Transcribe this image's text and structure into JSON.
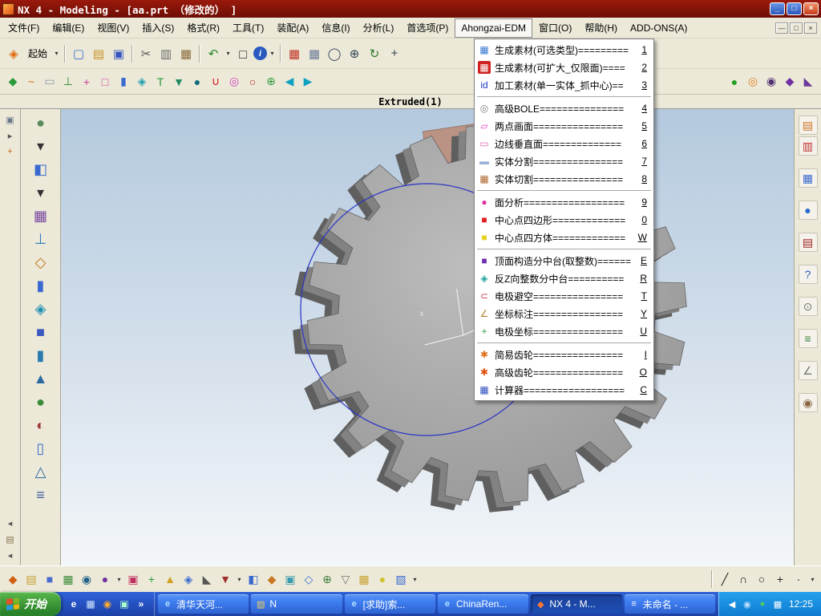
{
  "window": {
    "title": "NX 4 - Modeling - [aa.prt （修改的） ]",
    "controls": {
      "min": "_",
      "max": "□",
      "close": "×"
    }
  },
  "menubar": {
    "items": [
      "文件(F)",
      "编辑(E)",
      "视图(V)",
      "插入(S)",
      "格式(R)",
      "工具(T)",
      "装配(A)",
      "信息(I)",
      "分析(L)",
      "首选项(P)",
      "Ahongzai-EDM",
      "窗口(O)",
      "帮助(H)",
      "ADD-ONS(A)"
    ],
    "active_index": 10,
    "mdi": {
      "min": "—",
      "restore": "□",
      "close": "×"
    }
  },
  "toolbar_main": {
    "icons": [
      {
        "name": "nx-compass",
        "glyph": "◈",
        "color": "#e06a10"
      },
      {
        "name": "start-dropdown",
        "label": "起始"
      },
      {
        "name": "dropdown-arrow",
        "glyph": "▾",
        "small": true
      },
      {
        "sep": true
      },
      {
        "name": "new-file",
        "glyph": "▢",
        "color": "#3a6ad0"
      },
      {
        "name": "open-file",
        "glyph": "▤",
        "color": "#c89020"
      },
      {
        "name": "save",
        "glyph": "▣",
        "color": "#3555c0"
      },
      {
        "sep": true
      },
      {
        "name": "cut",
        "glyph": "✂",
        "color": "#555555"
      },
      {
        "name": "copy",
        "glyph": "▥",
        "color": "#6a6a6a"
      },
      {
        "name": "paste",
        "glyph": "▦",
        "color": "#8a6a3a"
      },
      {
        "sep": true
      },
      {
        "name": "undo",
        "glyph": "↶",
        "color": "#2a8a2a"
      },
      {
        "name": "dropdown-arrow",
        "glyph": "▾",
        "small": true
      },
      {
        "name": "move-object",
        "glyph": "◻",
        "color": "#555555"
      },
      {
        "name": "info",
        "glyph": "i",
        "color": "#ffffff",
        "bg": "#2a5ac0",
        "circle": true
      },
      {
        "name": "dropdown-arrow",
        "glyph": "▾",
        "small": true
      },
      {
        "sep": true
      },
      {
        "name": "display-part",
        "glyph": "▦",
        "color": "#c03020"
      },
      {
        "name": "show-hide",
        "glyph": "▦",
        "color": "#6a7a9a"
      },
      {
        "name": "zoom-view",
        "glyph": "◯",
        "color": "#334455"
      },
      {
        "name": "zoom-in-out",
        "glyph": "⊕",
        "color": "#334455"
      },
      {
        "name": "rotate-view",
        "glyph": "↻",
        "color": "#2a7a2a"
      },
      {
        "name": "pan-view",
        "glyph": "+",
        "color": "#334455"
      }
    ]
  },
  "toolbar_features": {
    "icons": [
      {
        "name": "sketch",
        "glyph": "◆",
        "color": "#2a9a3a"
      },
      {
        "name": "spline",
        "glyph": "~",
        "color": "#e07020"
      },
      {
        "name": "datum-plane",
        "glyph": "▭",
        "color": "#8a98a8"
      },
      {
        "name": "datum-axis",
        "glyph": "⊥",
        "color": "#2a8a2a"
      },
      {
        "name": "datum-csys",
        "glyph": "+",
        "color": "#d040a0"
      },
      {
        "name": "point-set",
        "glyph": "□",
        "color": "#d040a0"
      },
      {
        "name": "extrude",
        "glyph": "▮",
        "color": "#3a6ad0"
      },
      {
        "name": "revolve",
        "glyph": "◈",
        "color": "#20a0b0"
      },
      {
        "name": "sweep",
        "glyph": "T",
        "color": "#2a9a3a"
      },
      {
        "name": "tube",
        "glyph": "▼",
        "color": "#208a60"
      },
      {
        "name": "sphere",
        "glyph": "●",
        "color": "#106a7a"
      },
      {
        "name": "hole",
        "glyph": "∪",
        "color": "#d02020"
      },
      {
        "name": "boss",
        "glyph": "◎",
        "color": "#d040c0"
      },
      {
        "name": "pocket",
        "glyph": "○",
        "color": "#c02020"
      },
      {
        "name": "pad",
        "glyph": "⊕",
        "color": "#2a9a3a"
      },
      {
        "name": "trim-body",
        "glyph": "◀",
        "color": "#10a0c0"
      },
      {
        "name": "split-body",
        "glyph": "▶",
        "color": "#10a0c0"
      },
      {
        "grow": true
      },
      {
        "name": "unite",
        "glyph": "●",
        "color": "#20a020"
      },
      {
        "name": "subtract",
        "glyph": "◎",
        "color": "#e08020"
      },
      {
        "name": "intersect",
        "glyph": "◉",
        "color": "#503070"
      },
      {
        "name": "blend",
        "glyph": "◆",
        "color": "#7030a0"
      },
      {
        "name": "chamfer",
        "glyph": "◣",
        "color": "#6a3a9a"
      }
    ]
  },
  "cue_bar": {
    "label": "Extruded(1)"
  },
  "canvas": {
    "axis_label": "x"
  },
  "left_strip": {
    "icons": [
      {
        "name": "selection-filter",
        "glyph": "▣",
        "color": "#667788"
      },
      {
        "name": "scroll-up",
        "glyph": "▸",
        "color": "#555555"
      },
      {
        "name": "snap-toggle",
        "glyph": "+",
        "color": "#cc6610"
      },
      {
        "grow": true
      },
      {
        "name": "collapse-panel",
        "glyph": "◂",
        "color": "#555555"
      },
      {
        "name": "resource-tab",
        "glyph": "▤",
        "color": "#887755"
      },
      {
        "name": "collapse-panel-2",
        "glyph": "◂",
        "color": "#555555"
      }
    ]
  },
  "left_toolbar": {
    "icons": [
      {
        "name": "selection-ball",
        "glyph": "●",
        "color": "#5a8a5a"
      },
      {
        "name": "dropdown-arrow",
        "glyph": "▾",
        "small": true
      },
      {
        "name": "shaded-view",
        "glyph": "◧",
        "color": "#3a6ad0"
      },
      {
        "name": "dropdown-arrow",
        "glyph": "▾",
        "small": true
      },
      {
        "name": "datum-grid",
        "glyph": "▦",
        "color": "#7a4aa0"
      },
      {
        "name": "csys",
        "glyph": "⊥",
        "color": "#2a7ac0"
      },
      {
        "name": "sketch-tool",
        "glyph": "◇",
        "color": "#c07a20"
      },
      {
        "name": "extrude-tool",
        "glyph": "▮",
        "color": "#3a6ad0"
      },
      {
        "name": "revolve-tool",
        "glyph": "◈",
        "color": "#2090b0"
      },
      {
        "name": "block-tool",
        "glyph": "■",
        "color": "#3a5ac0"
      },
      {
        "name": "cylinder-tool",
        "glyph": "▮",
        "color": "#2a7ab0"
      },
      {
        "name": "cone-tool",
        "glyph": "▲",
        "color": "#2a6aa0"
      },
      {
        "name": "unite-tool",
        "glyph": "●",
        "color": "#3a8a3a"
      },
      {
        "name": "subtract-tool",
        "glyph": "◐",
        "color": "#a03a3a"
      },
      {
        "name": "cylinder-2",
        "glyph": "▯",
        "color": "#3a6ad0"
      },
      {
        "name": "cone-2",
        "glyph": "△",
        "color": "#2a6aa0"
      },
      {
        "name": "thread-tool",
        "glyph": "≡",
        "color": "#3a5a9a"
      }
    ]
  },
  "right_toolbar": {
    "icons": [
      {
        "name": "assembly-navigator",
        "glyph": "▤",
        "color": "#d07020"
      },
      {
        "name": "constraint-navigator",
        "glyph": "▥",
        "color": "#c03030"
      },
      {
        "gap": true
      },
      {
        "name": "part-navigator",
        "glyph": "▦",
        "color": "#3a6ad0"
      },
      {
        "gap": true
      },
      {
        "name": "web-browser",
        "glyph": "●",
        "color": "#2a6ad0"
      },
      {
        "gap": true
      },
      {
        "name": "history",
        "glyph": "▤",
        "color": "#a02020"
      },
      {
        "gap": true
      },
      {
        "name": "help",
        "glyph": "?",
        "color": "#2a5ac0"
      },
      {
        "gap": true
      },
      {
        "name": "clock",
        "glyph": "⊙",
        "color": "#777777"
      },
      {
        "gap": true
      },
      {
        "name": "materials",
        "glyph": "≡",
        "color": "#3a7a3a"
      },
      {
        "gap": true
      },
      {
        "name": "measure",
        "glyph": "∠",
        "color": "#777777"
      },
      {
        "gap": true
      },
      {
        "name": "roles",
        "glyph": "◉",
        "color": "#886644"
      }
    ]
  },
  "dropdown_menu": {
    "title": "Ahongzai-EDM",
    "groups": [
      [
        {
          "name": "gen-material-select",
          "icon": {
            "glyph": "▦",
            "color": "#3a7ad0"
          },
          "label": "生成素材(可选类型)=========",
          "key": "1"
        },
        {
          "name": "gen-material-expand",
          "icon": {
            "glyph": "▦",
            "color": "#ffffff",
            "bg": "#d02020"
          },
          "label": "生成素材(可扩大_仅限面)====",
          "key": "2"
        },
        {
          "name": "machining-material",
          "icon": {
            "glyph": "id",
            "color": "#2040c0"
          },
          "label": "加工素材(单一实体_抓中心)==",
          "key": "3"
        }
      ],
      [
        {
          "name": "advanced-bole",
          "icon": {
            "glyph": "◎",
            "color": "#808080"
          },
          "label": "高级BOLE===============",
          "key": "4"
        },
        {
          "name": "two-point-plane",
          "icon": {
            "glyph": "▱",
            "color": "#e040c0"
          },
          "label": "两点画面================",
          "key": "5"
        },
        {
          "name": "edge-perpendicular-plane",
          "icon": {
            "glyph": "▭",
            "color": "#e060b0"
          },
          "label": "边线垂直面==============",
          "key": "6"
        },
        {
          "name": "solid-split",
          "icon": {
            "glyph": "▬",
            "color": "#9ab0d8"
          },
          "label": "实体分割================",
          "key": "7"
        },
        {
          "name": "solid-cut",
          "icon": {
            "glyph": "▦",
            "color": "#b06a30"
          },
          "label": "实体切割================",
          "key": "8"
        }
      ],
      [
        {
          "name": "face-analysis",
          "icon": {
            "glyph": "●",
            "color": "#e030a0"
          },
          "label": "面分析==================",
          "key": "9"
        },
        {
          "name": "center-point-quad",
          "icon": {
            "glyph": "■",
            "color": "#e02020"
          },
          "label": "中心点四边形=============",
          "key": "0"
        },
        {
          "name": "center-point-box",
          "icon": {
            "glyph": "■",
            "color": "#e8d020"
          },
          "label": "中心点四方体=============",
          "key": "W"
        }
      ],
      [
        {
          "name": "top-face-split",
          "icon": {
            "glyph": "■",
            "color": "#7030b0"
          },
          "label": "顶面构造分中台(取整数)======",
          "key": "E"
        },
        {
          "name": "reverse-z-split",
          "icon": {
            "glyph": "◈",
            "color": "#20a0a0"
          },
          "label": "反Z向整数分中台==========",
          "key": "R"
        },
        {
          "name": "electrode-clearance",
          "icon": {
            "glyph": "⊂",
            "color": "#d04040"
          },
          "label": "电极避空================",
          "key": "T"
        },
        {
          "name": "coordinate-dimension",
          "icon": {
            "glyph": "∠",
            "color": "#b08030"
          },
          "label": "坐标标注================",
          "key": "Y"
        },
        {
          "name": "electrode-coordinate",
          "icon": {
            "glyph": "+",
            "color": "#30a040"
          },
          "label": "电极坐标================",
          "key": "U"
        }
      ],
      [
        {
          "name": "simple-gear",
          "icon": {
            "glyph": "✱",
            "color": "#e07020"
          },
          "label": "简易齿轮================",
          "key": "I"
        },
        {
          "name": "advanced-gear",
          "icon": {
            "glyph": "✱",
            "color": "#e05010"
          },
          "label": "高级齿轮================",
          "key": "O"
        },
        {
          "name": "calculator",
          "icon": {
            "glyph": "▦",
            "color": "#3050c0"
          },
          "label": "计算器==================",
          "key": "C"
        }
      ]
    ]
  },
  "bottom_toolbar": {
    "icons": [
      {
        "name": "snap-point",
        "glyph": "◆",
        "color": "#d06010"
      },
      {
        "name": "end-point",
        "glyph": "▤",
        "color": "#c8a030"
      },
      {
        "name": "mid-point",
        "glyph": "■",
        "color": "#4a6ad0"
      },
      {
        "name": "intersection-point",
        "glyph": "▦",
        "color": "#3a8a3a"
      },
      {
        "name": "arc-center",
        "glyph": "◉",
        "color": "#20608a"
      },
      {
        "name": "quadrant-point",
        "glyph": "●",
        "color": "#7030a0"
      },
      {
        "name": "dropdown-arrow",
        "glyph": "▾",
        "small": true
      },
      {
        "name": "existing-point",
        "glyph": "▣",
        "color": "#c03060"
      },
      {
        "name": "point-constructor",
        "glyph": "+",
        "color": "#2a9a3a"
      },
      {
        "name": "face-rule",
        "glyph": "▲",
        "color": "#d0a020"
      },
      {
        "name": "edge-rule",
        "glyph": "◈",
        "color": "#3a6ad0"
      },
      {
        "name": "corner-rule",
        "glyph": "◣",
        "color": "#555555"
      },
      {
        "name": "direction-flip",
        "glyph": "▼",
        "color": "#a03030"
      },
      {
        "name": "dropdown-arrow",
        "glyph": "▾",
        "small": true
      },
      {
        "name": "shaded-toggle",
        "glyph": "◧",
        "color": "#3a6ad0"
      },
      {
        "name": "wireframe-toggle",
        "glyph": "◆",
        "color": "#c87820"
      },
      {
        "name": "layer-settings",
        "glyph": "▣",
        "color": "#3a9ab0"
      },
      {
        "name": "work-layer",
        "glyph": "◇",
        "color": "#3a6ad0"
      },
      {
        "name": "grid-toggle",
        "glyph": "⊕",
        "color": "#3a7a3a"
      },
      {
        "name": "orient-view",
        "glyph": "▽",
        "color": "#777777"
      },
      {
        "name": "snap-settings",
        "glyph": "▦",
        "color": "#c8a030"
      },
      {
        "name": "link-toggle",
        "glyph": "●",
        "color": "#d0c030"
      },
      {
        "name": "hatch-toggle",
        "glyph": "▧",
        "color": "#3a6ad0"
      },
      {
        "name": "dropdown-arrow",
        "glyph": "▾",
        "small": true
      },
      {
        "grow": true
      },
      {
        "sep": true
      },
      {
        "name": "line-tool",
        "glyph": "╱",
        "color": "#222222"
      },
      {
        "name": "arc-tool",
        "glyph": "∩",
        "color": "#222222"
      },
      {
        "name": "circle-tool",
        "glyph": "○",
        "color": "#222222"
      },
      {
        "name": "fillet-tool",
        "glyph": "+",
        "color": "#222222"
      },
      {
        "name": "point-tool",
        "glyph": "·",
        "color": "#222222"
      },
      {
        "name": "dropdown-arrow",
        "glyph": "▾",
        "small": true
      }
    ]
  },
  "taskbar": {
    "start_label": "开始",
    "quick_launch": [
      {
        "name": "internet-explorer",
        "glyph": "e",
        "color": "#ffffff"
      },
      {
        "name": "show-desktop",
        "glyph": "▦",
        "color": "#cfe4ff"
      },
      {
        "name": "media-player",
        "glyph": "◉",
        "color": "#ffaa33"
      },
      {
        "name": "messenger",
        "glyph": "▣",
        "color": "#aaffcc"
      },
      {
        "name": "more-chevron",
        "glyph": "»",
        "color": "#ffffff"
      }
    ],
    "tasks": [
      {
        "name": "qinghua-tianhe",
        "label": "清华天河...",
        "icon": {
          "glyph": "e",
          "color": "#aee0ff"
        }
      },
      {
        "name": "folder-n",
        "label": "N",
        "icon": {
          "glyph": "▨",
          "color": "#f5d060"
        }
      },
      {
        "name": "qiuzhu-suo",
        "label": "[求助]索...",
        "icon": {
          "glyph": "e",
          "color": "#aee0ff"
        }
      },
      {
        "name": "chinaren",
        "label": "ChinaRen...",
        "icon": {
          "glyph": "e",
          "color": "#aee0ff"
        }
      },
      {
        "name": "nx4-modeling",
        "label": "NX 4 - M...",
        "active": true,
        "icon": {
          "glyph": "◆",
          "color": "#ff7733"
        }
      },
      {
        "name": "untitled-notepad",
        "label": "未命名 - ...",
        "icon": {
          "glyph": "≡",
          "color": "#ffffff"
        }
      }
    ],
    "tray": {
      "icons": [
        {
          "name": "hide-icons-chevron",
          "glyph": "◀",
          "color": "#ffffff"
        },
        {
          "name": "volume",
          "glyph": "◉",
          "color": "#bfe0ff"
        },
        {
          "name": "antivirus",
          "glyph": "●",
          "color": "#55cc55"
        },
        {
          "name": "ime",
          "glyph": "▦",
          "color": "#ffffff"
        }
      ],
      "time": "12:25"
    }
  },
  "colors": {
    "titlebar_top": "#9a1a0c",
    "titlebar_bottom": "#6e0d03",
    "menu_bg": "#ece9d8",
    "dropdown_bg": "#ffffff",
    "canvas_top": "#b4c9de",
    "canvas_bottom": "#f3f6f9",
    "taskbar_top": "#2f62d8",
    "taskbar_bottom": "#1c41a8",
    "start_top": "#59b84b",
    "start_bottom": "#2a822a",
    "task_btn": "#3d7df0",
    "task_btn_active": "#1c50b4",
    "tray_top": "#23a0ee",
    "tray_bottom": "#0f7cd0",
    "gear_face": "#989898",
    "gear_face_light": "#bdbdbd",
    "gear_mid": "#828282",
    "gear_side": "#5f5f5f",
    "sketch_blue": "#2b35c4",
    "fragment": "#bb9384",
    "flag_red": "#e4512b",
    "flag_green": "#7eb82a",
    "flag_blue": "#2a9ae0",
    "flag_yellow": "#f0b30f"
  }
}
